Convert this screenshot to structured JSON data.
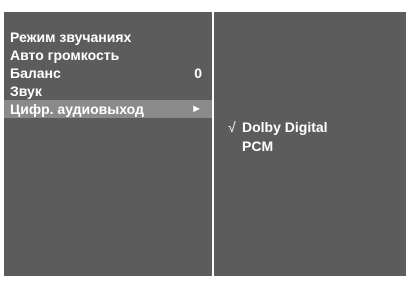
{
  "sound_menu": {
    "items": [
      {
        "label": "Режим звучаниях"
      },
      {
        "label": "Авто громкость"
      },
      {
        "label": "Баланс",
        "value": "0"
      },
      {
        "label": "Звук"
      },
      {
        "label": "Цифр. аудиовыход",
        "arrow": "►",
        "selected": true
      }
    ]
  },
  "digital_output": {
    "check_mark": "√",
    "options": [
      {
        "label": "Dolby Digital",
        "checked": true
      },
      {
        "label": "PCM",
        "checked": false
      }
    ]
  },
  "colors": {
    "panel": "#5c5c5c",
    "highlight": "#8a8a8a",
    "divider": "#ffffff",
    "text": "#ffffff"
  }
}
